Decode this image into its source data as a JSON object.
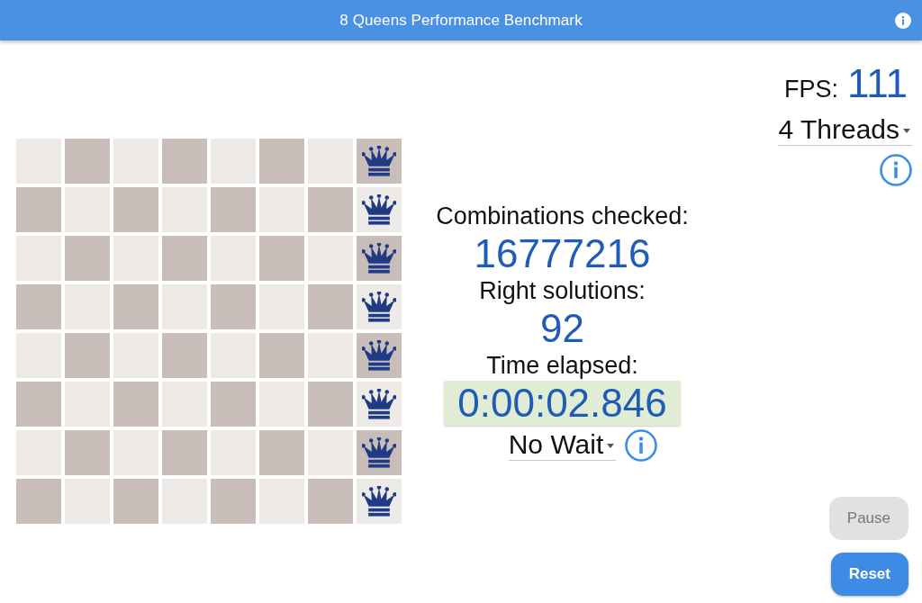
{
  "app_bar": {
    "title": "8 Queens Performance Benchmark"
  },
  "board": {
    "rows": [
      {
        "cells": [
          {
            "queen": false
          },
          {
            "queen": false
          },
          {
            "queen": false
          },
          {
            "queen": false
          },
          {
            "queen": false
          },
          {
            "queen": false
          },
          {
            "queen": false
          },
          {
            "queen": true
          }
        ]
      },
      {
        "cells": [
          {
            "queen": false
          },
          {
            "queen": false
          },
          {
            "queen": false
          },
          {
            "queen": false
          },
          {
            "queen": false
          },
          {
            "queen": false
          },
          {
            "queen": false
          },
          {
            "queen": true
          }
        ]
      },
      {
        "cells": [
          {
            "queen": false
          },
          {
            "queen": false
          },
          {
            "queen": false
          },
          {
            "queen": false
          },
          {
            "queen": false
          },
          {
            "queen": false
          },
          {
            "queen": false
          },
          {
            "queen": true
          }
        ]
      },
      {
        "cells": [
          {
            "queen": false
          },
          {
            "queen": false
          },
          {
            "queen": false
          },
          {
            "queen": false
          },
          {
            "queen": false
          },
          {
            "queen": false
          },
          {
            "queen": false
          },
          {
            "queen": true
          }
        ]
      },
      {
        "cells": [
          {
            "queen": false
          },
          {
            "queen": false
          },
          {
            "queen": false
          },
          {
            "queen": false
          },
          {
            "queen": false
          },
          {
            "queen": false
          },
          {
            "queen": false
          },
          {
            "queen": true
          }
        ]
      },
      {
        "cells": [
          {
            "queen": false
          },
          {
            "queen": false
          },
          {
            "queen": false
          },
          {
            "queen": false
          },
          {
            "queen": false
          },
          {
            "queen": false
          },
          {
            "queen": false
          },
          {
            "queen": true
          }
        ]
      },
      {
        "cells": [
          {
            "queen": false
          },
          {
            "queen": false
          },
          {
            "queen": false
          },
          {
            "queen": false
          },
          {
            "queen": false
          },
          {
            "queen": false
          },
          {
            "queen": false
          },
          {
            "queen": true
          }
        ]
      },
      {
        "cells": [
          {
            "queen": false
          },
          {
            "queen": false
          },
          {
            "queen": false
          },
          {
            "queen": false
          },
          {
            "queen": false
          },
          {
            "queen": false
          },
          {
            "queen": false
          },
          {
            "queen": true
          }
        ]
      }
    ]
  },
  "stats": [
    {
      "label": "Combinations checked:",
      "value": "16777216",
      "highlighted": false
    },
    {
      "label": "Right solutions:",
      "value": "92",
      "highlighted": false
    },
    {
      "label": "Time elapsed:",
      "value": "0:00:02.846",
      "highlighted": true
    }
  ],
  "wait_dropdown": {
    "value": "No Wait"
  },
  "fps": {
    "label": "FPS:",
    "value": "111"
  },
  "threads_dropdown": {
    "value": "4 Threads"
  },
  "buttons": [
    {
      "label": "Pause",
      "disabled": true
    },
    {
      "label": "Reset",
      "disabled": false
    }
  ]
}
